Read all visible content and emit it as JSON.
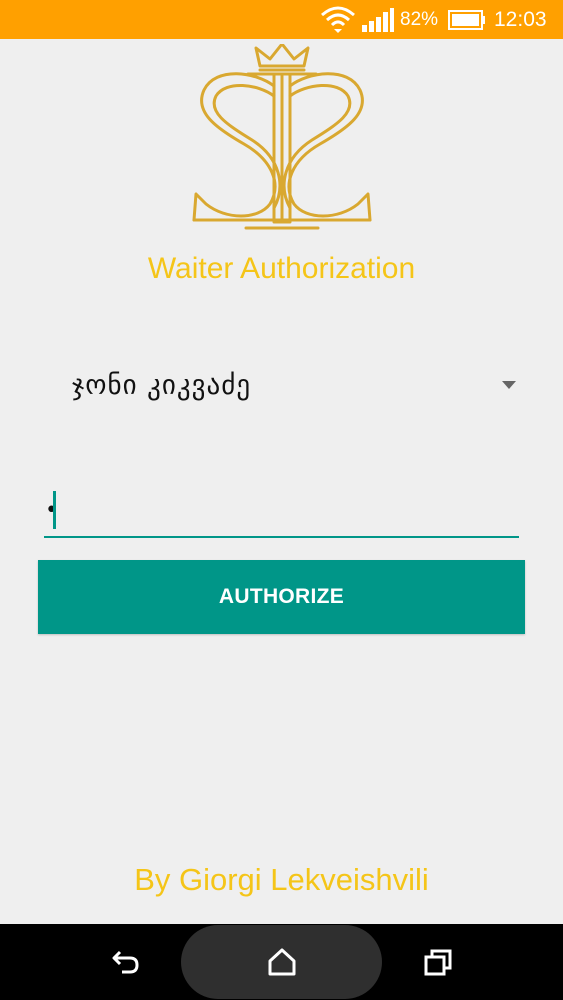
{
  "colors": {
    "status_bar": "#ffa000",
    "accent_gold": "#f5c518",
    "teal": "#009688",
    "background": "#efefef"
  },
  "status_bar": {
    "battery_percent": "82%",
    "time": "12:03",
    "icons": [
      "wifi-icon",
      "signal-icon",
      "battery-icon"
    ]
  },
  "logo": {
    "icon": "ss-crown-monogram-logo"
  },
  "title": "Waiter Authorization",
  "waiter_select": {
    "selected_value": "ჯონი კიკვაძე",
    "icon": "dropdown-arrow-icon"
  },
  "password_field": {
    "value": "•"
  },
  "authorize_button": {
    "label": "AUTHORIZE"
  },
  "footer": "By Giorgi Lekveishvili",
  "nav_bar": {
    "icons": [
      "back-icon",
      "home-icon",
      "recents-icon"
    ]
  }
}
